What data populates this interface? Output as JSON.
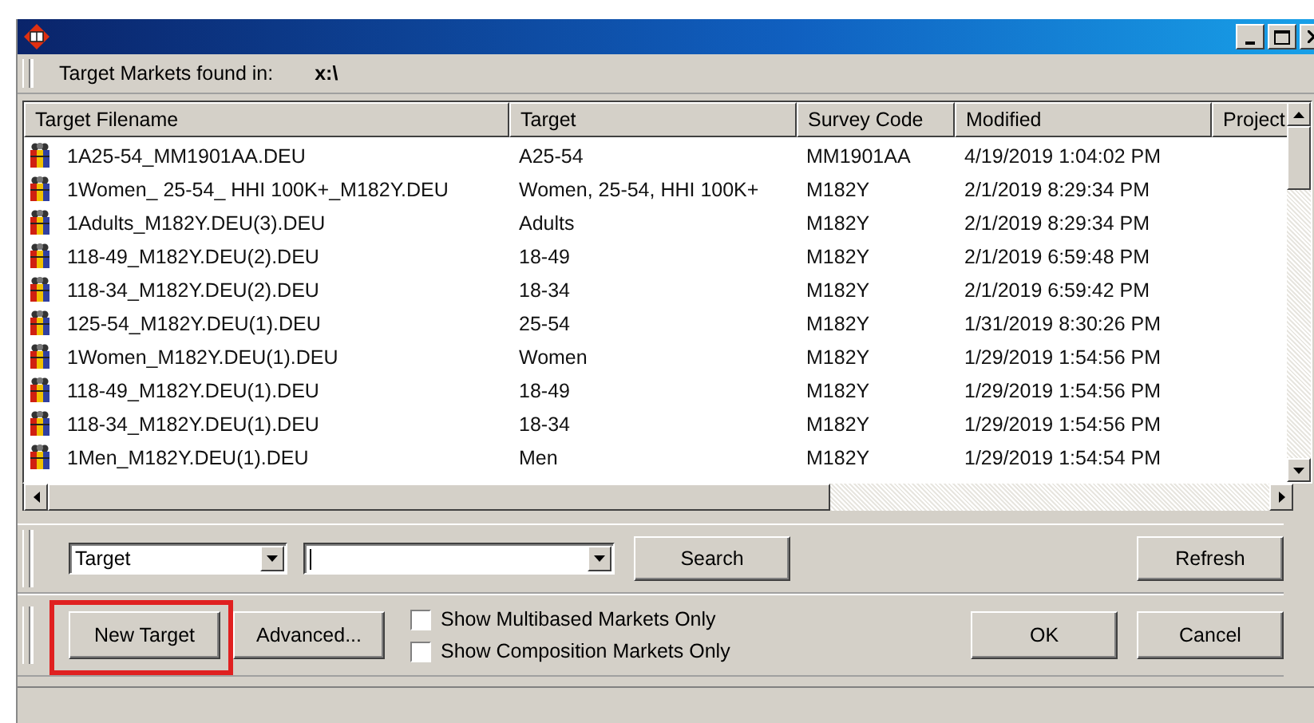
{
  "toolbar": {
    "label": "Target Markets found in:",
    "path": "x:\\"
  },
  "table": {
    "columns": [
      "Target Filename",
      "Target",
      "Survey Code",
      "Modified",
      "Project"
    ],
    "rows": [
      [
        "1A25-54_MM1901AA.DEU",
        "A25-54",
        "MM1901AA",
        "4/19/2019 1:04:02 PM"
      ],
      [
        "1Women_ 25-54_ HHI 100K+_M182Y.DEU",
        "Women, 25-54, HHI 100K+",
        "M182Y",
        "2/1/2019 8:29:34 PM"
      ],
      [
        "1Adults_M182Y.DEU(3).DEU",
        "Adults",
        "M182Y",
        "2/1/2019 8:29:34 PM"
      ],
      [
        "118-49_M182Y.DEU(2).DEU",
        "18-49",
        "M182Y",
        "2/1/2019 6:59:48 PM"
      ],
      [
        "118-34_M182Y.DEU(2).DEU",
        "18-34",
        "M182Y",
        "2/1/2019 6:59:42 PM"
      ],
      [
        "125-54_M182Y.DEU(1).DEU",
        "25-54",
        "M182Y",
        "1/31/2019 8:30:26 PM"
      ],
      [
        "1Women_M182Y.DEU(1).DEU",
        "Women",
        "M182Y",
        "1/29/2019 1:54:56 PM"
      ],
      [
        "118-49_M182Y.DEU(1).DEU",
        "18-49",
        "M182Y",
        "1/29/2019 1:54:56 PM"
      ],
      [
        "118-34_M182Y.DEU(1).DEU",
        "18-34",
        "M182Y",
        "1/29/2019 1:54:56 PM"
      ],
      [
        "1Men_M182Y.DEU(1).DEU",
        "Men",
        "M182Y",
        "1/29/2019 1:54:54 PM"
      ]
    ]
  },
  "search": {
    "field": "Target",
    "search_button": "Search",
    "refresh_button": "Refresh"
  },
  "actions": {
    "buttons": [
      {
        "label": "New Target",
        "highlighted": true
      },
      {
        "label": "Advanced...",
        "highlighted": false
      }
    ],
    "options": [
      {
        "label": "Show Multibased Markets Only",
        "checked": false
      },
      {
        "label": "Show Composition Markets Only",
        "checked": false
      }
    ],
    "ok": "OK",
    "cancel": "Cancel"
  }
}
